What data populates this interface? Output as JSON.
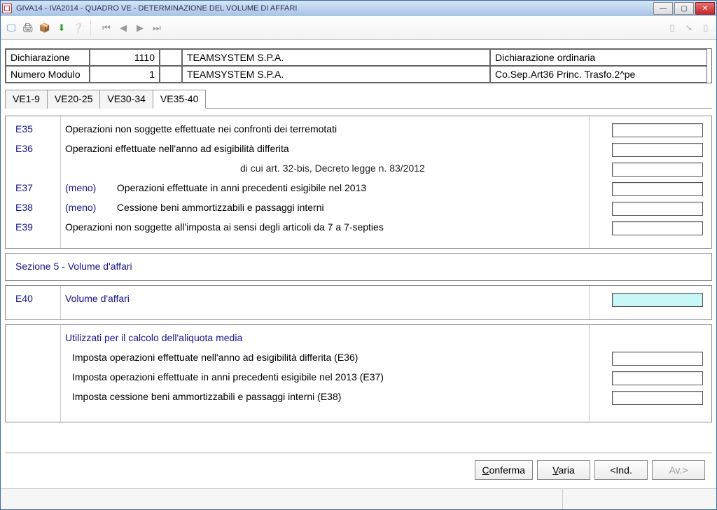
{
  "window": {
    "title": "GIVA14 -  IVA2014 -  QUADRO VE - DETERMINAZIONE DEL VOLUME DI AFFARI"
  },
  "header": {
    "dichiarazione_label": "Dichiarazione",
    "dichiarazione_num": "1110",
    "modulo_label": "Numero Modulo",
    "modulo_num": "1",
    "company1": "TEAMSYSTEM S.P.A.",
    "company2": "TEAMSYSTEM S.P.A.",
    "tipo_dich": "Dichiarazione ordinaria",
    "co_sep": "Co.Sep.Art36   Princ.   Trasfo.2^pe"
  },
  "tabs": {
    "t1": "VE1-9",
    "t2": "VE20-25",
    "t3": "VE30-34",
    "t4": "VE35-40"
  },
  "rows": {
    "e35_code": "E35",
    "e35": "Operazioni non soggette effettuate nei confronti dei terremotati",
    "e36_code": "E36",
    "e36": "Operazioni effettuate nell'anno ad esigibilità differita",
    "e36_sub": "di cui art. 32-bis, Decreto legge n. 83/2012",
    "e37_code": "E37",
    "meno": "(meno)",
    "e37": "Operazioni effettuate in anni precedenti esigibile nel 2013",
    "e38_code": "E38",
    "e38": "Cessione beni ammortizzabili e passaggi interni",
    "e39_code": "E39",
    "e39": "Operazioni non soggette all'imposta ai sensi degli articoli da 7 a 7-septies"
  },
  "sezione5": "Sezione 5 - Volume d'affari",
  "e40": {
    "code": "E40",
    "label": "Volume d'affari"
  },
  "aliquota": {
    "title": "Utilizzati per il calcolo dell'aliquota media",
    "l1": "Imposta operazioni effettuate nell'anno ad esigibilità differita (E36)",
    "l2": "Imposta operazioni effettuate in anni precedenti esigibile nel 2013 (E37)",
    "l3": "Imposta cessione beni ammortizzabili e passaggi interni (E38)"
  },
  "buttons": {
    "conferma": "Conferma",
    "varia": "Varia",
    "ind": "<Ind.",
    "av": "Av.>"
  }
}
